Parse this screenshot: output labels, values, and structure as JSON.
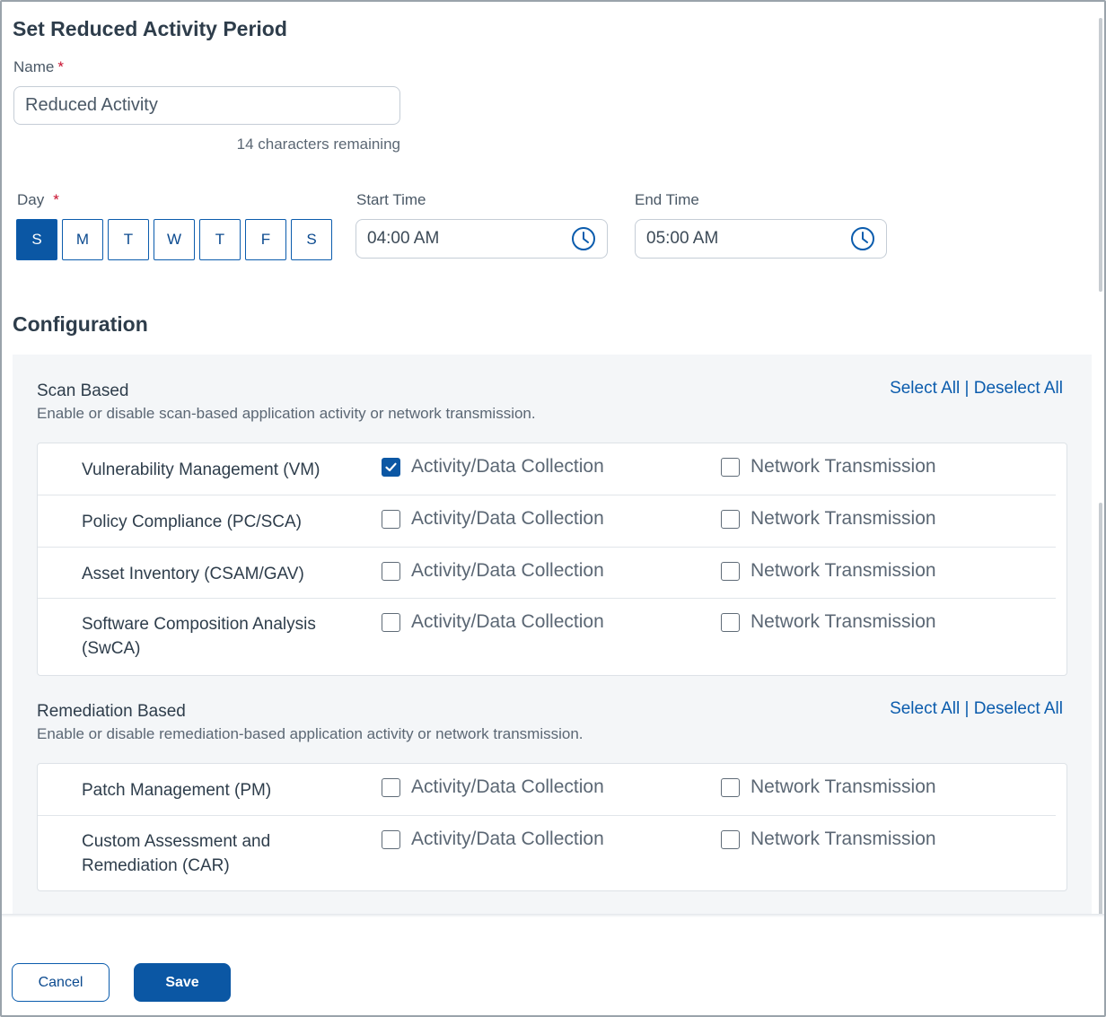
{
  "title": "Set Reduced Activity Period",
  "name_field": {
    "label": "Name",
    "required_mark": "*",
    "value": "Reduced Activity",
    "counter": "14 characters remaining"
  },
  "day_field": {
    "label": "Day",
    "required_mark": "*",
    "days": [
      {
        "label": "S",
        "selected": true
      },
      {
        "label": "M",
        "selected": false
      },
      {
        "label": "T",
        "selected": false
      },
      {
        "label": "W",
        "selected": false
      },
      {
        "label": "T",
        "selected": false
      },
      {
        "label": "F",
        "selected": false
      },
      {
        "label": "S",
        "selected": false
      }
    ]
  },
  "start_time": {
    "label": "Start Time",
    "value": "04:00 AM",
    "icon": "clock-icon"
  },
  "end_time": {
    "label": "End Time",
    "value": "05:00 AM",
    "icon": "clock-icon"
  },
  "configuration": {
    "title": "Configuration",
    "select_all": "Select All",
    "separator": " | ",
    "deselect_all": "Deselect All",
    "option_activity": "Activity/Data Collection",
    "option_network": "Network Transmission",
    "scan_based": {
      "title": "Scan Based",
      "description": "Enable or disable scan-based application activity or network transmission.",
      "rows": [
        {
          "name": "Vulnerability Management (VM)",
          "activity": true,
          "network": false
        },
        {
          "name": "Policy Compliance (PC/SCA)",
          "activity": false,
          "network": false
        },
        {
          "name": "Asset Inventory (CSAM/GAV)",
          "activity": false,
          "network": false
        },
        {
          "name": "Software Composition Analysis (SwCA)",
          "activity": false,
          "network": false
        }
      ]
    },
    "remediation_based": {
      "title": "Remediation Based",
      "description": "Enable or disable remediation-based application activity or network transmission.",
      "rows": [
        {
          "name": "Patch Management (PM)",
          "activity": false,
          "network": false
        },
        {
          "name": "Custom Assessment and Remediation (CAR)",
          "activity": false,
          "network": false
        }
      ]
    }
  },
  "footer": {
    "cancel_label": "Cancel",
    "save_label": "Save"
  },
  "colors": {
    "accent": "#0b57a4",
    "link": "#0b5cad",
    "panel_bg": "#f4f6f8",
    "required": "#c8102e"
  }
}
